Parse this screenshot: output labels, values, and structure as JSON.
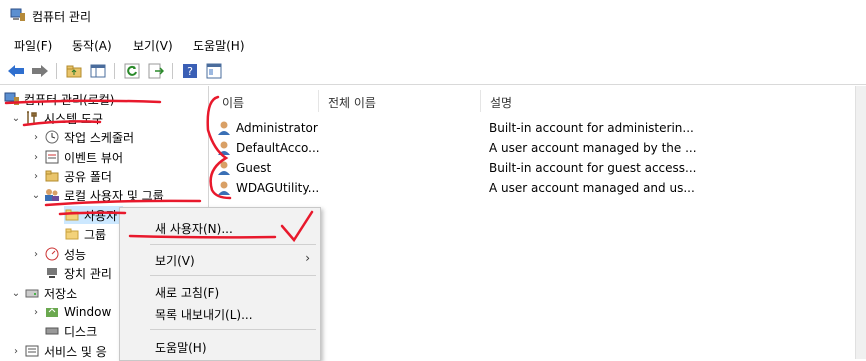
{
  "window": {
    "title": "컴퓨터 관리",
    "app_icon": "computer-management-icon"
  },
  "menu": [
    "파일(F)",
    "동작(A)",
    "보기(V)",
    "도움말(H)"
  ],
  "toolbar": {
    "buttons": [
      "back-arrow-icon",
      "forward-arrow-icon",
      "up-folder-icon",
      "show-hide-tree-icon",
      "refresh-icon",
      "export-list-icon",
      "help-icon",
      "properties-icon"
    ]
  },
  "tree": {
    "root": "컴퓨터 관리(로컬)",
    "system_tools": "시스템 도구",
    "task_scheduler": "작업 스케줄러",
    "event_viewer": "이벤트 뷰어",
    "shared_folders": "공유 폴더",
    "local_users_groups": "로컬 사용자 및 그룹",
    "users": "사용자",
    "groups": "그룹",
    "performance": "성능",
    "device_manager": "장치 관리",
    "storage": "저장소",
    "windows_backup": "Window",
    "disk_management": "디스크 ",
    "services_apps": "서비스 및 응"
  },
  "list": {
    "columns": [
      "이름",
      "전체 이름",
      "설명"
    ],
    "rows": [
      {
        "name": "Administrator",
        "full_name": "",
        "description": "Built-in account for administerin..."
      },
      {
        "name": "DefaultAcco...",
        "full_name": "",
        "description": "A user account managed by the ..."
      },
      {
        "name": "Guest",
        "full_name": "",
        "description": "Built-in account for guest access..."
      },
      {
        "name": "WDAGUtility...",
        "full_name": "",
        "description": "A user account managed and us..."
      }
    ]
  },
  "context_menu": {
    "new_user": "새 사용자(N)...",
    "view": "보기(V)",
    "refresh": "새로 고침(F)",
    "export": "목록 내보내기(L)...",
    "help": "도움말(H)"
  },
  "colors": {
    "selection": "#cce8ff",
    "annotation": "#e8192c",
    "menu_bg": "#f2f2f2"
  }
}
